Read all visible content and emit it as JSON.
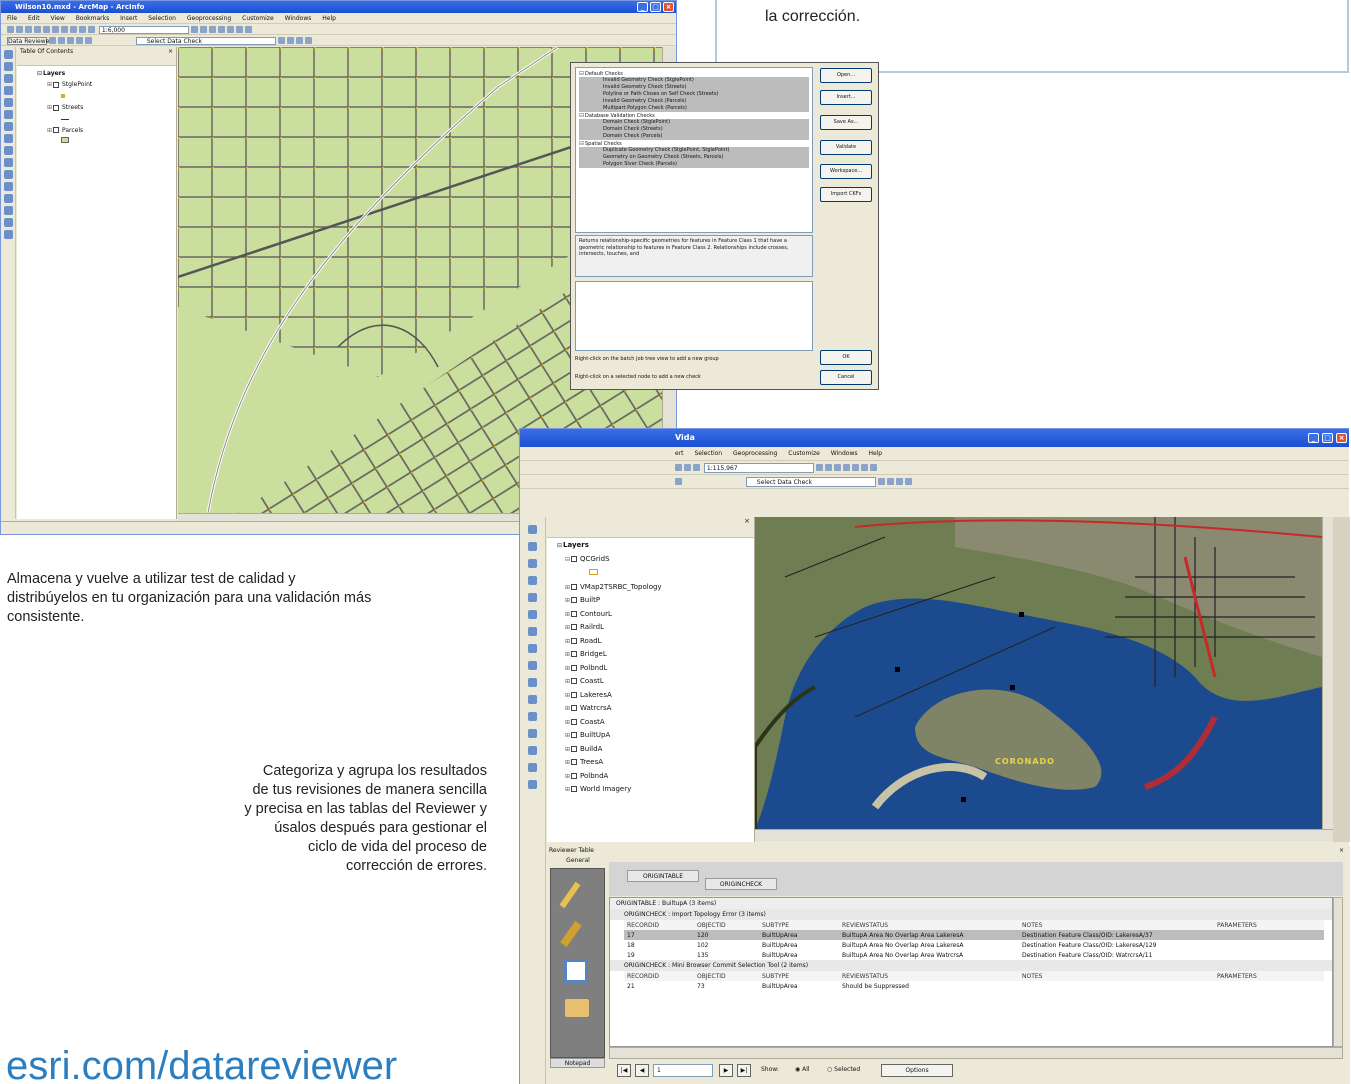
{
  "intro_text": "la corrección.",
  "caption_left": "Almacena y vuelve a utilizar test de calidad y distribúyelos en tu organización para una validación más consistente.",
  "caption_right": "Categoriza y agrupa los resultados de tus revisiones de manera sencilla y precisa en las tablas del Reviewer y úsalos después para gestionar el ciclo de vida del proceso de corrección de errores.",
  "url": "esri.com/datareviewer",
  "window1": {
    "title": "Wilson10.mxd - ArcMap - ArcInfo",
    "menu": [
      "File",
      "Edit",
      "View",
      "Bookmarks",
      "Insert",
      "Selection",
      "Geoprocessing",
      "Customize",
      "Windows",
      "Help"
    ],
    "scale": "1:6,000",
    "toolbar_name": "Data Reviewer",
    "select_data_check": "Select Data Check",
    "toc_title": "Table Of Contents",
    "layers": [
      "Layers",
      "StglePoint",
      "Streets",
      "Parcels"
    ]
  },
  "dialog": {
    "groups": [
      {
        "name": "Default Checks",
        "items": [
          "Invalid Geometry Check (StglePoint)",
          "Invalid Geometry Check (Streets)",
          "Polyline or Path Closes on Self Check (Streets)",
          "Invalid Geometry Check (Parcels)",
          "Multipart Polygon Check (Parcels)"
        ]
      },
      {
        "name": "Database Validation Checks",
        "items": [
          "Domain Check (StglePoint)",
          "Domain Check (Streets)",
          "Domain Check (Parcels)"
        ]
      },
      {
        "name": "Spatial Checks",
        "items": [
          "Duplicate Geometry Check (StglePoint, StglePoint)",
          "Geometry on Geometry Check (Streets, Parcels)",
          "Polygon Slver Check (Parcels)"
        ]
      }
    ],
    "description": "Returns relationship-specific geometries for features in Feature Class 1 that have a geometric relationship to features in Feature Class 2. Relationships include crosses, intersects, touches, and",
    "hint1": "Right-click on the batch job tree view to add a new group",
    "hint2": "Right-click on a selected node to add a new check",
    "buttons": [
      "Open...",
      "Insert...",
      "Save As...",
      "Validate",
      "Workspace...",
      "Import CKFs"
    ],
    "ok": "OK",
    "cancel": "Cancel"
  },
  "window2": {
    "title": "Vida",
    "menu": [
      "ert",
      "Selection",
      "Geoprocessing",
      "Customize",
      "Windows",
      "Help"
    ],
    "scale": "1:115,967",
    "select_data_check": "Select Data Check",
    "map_label": "CORONADO",
    "layers": [
      "Layers",
      "QCGridS",
      "VMap2TSRBC_Topology",
      "BuiltP",
      "ContourL",
      "RailrdL",
      "RoadL",
      "BridgeL",
      "PolbndL",
      "CoastL",
      "LakeresA",
      "WatrcrsA",
      "CoastA",
      "BuiltUpA",
      "BuildA",
      "TreesA",
      "PolbndA",
      "World Imagery"
    ],
    "reviewer_title": "Reviewer Table",
    "reviewer_tab": "General",
    "notepad": "Notepad",
    "group_tabs": [
      "ORIGINTABLE",
      "ORIGINCHECK"
    ],
    "group1": "ORIGINTABLE : BuiltupA (3 items)",
    "sub1": "ORIGINCHECK : Import Topology Error (3 items)",
    "sub2": "ORIGINCHECK : Mini Browser Commit Selection Tool (2 items)",
    "columns": [
      "RECORDID",
      "OBJECTID",
      "SUBTYPE",
      "REVIEWSTATUS",
      "NOTES",
      "PARAMETERS"
    ],
    "rows": [
      [
        "17",
        "120",
        "BuiltUpArea",
        "BuiltupA Area No Overlap Area LakeresA",
        "Destination Feature Class/OID: LakeresA/37",
        ""
      ],
      [
        "18",
        "102",
        "BuiltUpArea",
        "BuiltupA Area No Overlap Area LakeresA",
        "Destination Feature Class/OID: LakeresA/129",
        ""
      ],
      [
        "19",
        "135",
        "BuiltUpArea",
        "BuiltupA Area No Overlap Area WatrcrsA",
        "Destination Feature Class/OID: WatrcrsA/11",
        ""
      ]
    ],
    "row4": [
      "21",
      "73",
      "BuiltUpArea",
      "Should be Suppressed"
    ],
    "nav_page": "1",
    "show_label": "Show:",
    "opt_all": "All",
    "opt_selected": "Selected",
    "options_button": "Options"
  },
  "colors": {
    "map1_bg": "#cadf9e",
    "map2_water": "#1c4a8e",
    "title_blue": "#1c4fd1",
    "url": "#2b7ec0"
  }
}
